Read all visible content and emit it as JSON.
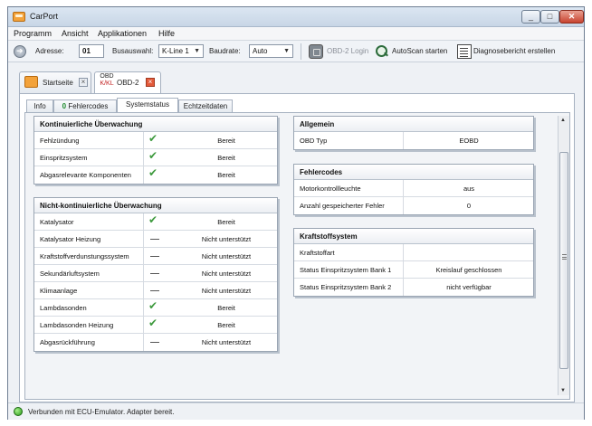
{
  "window": {
    "title": "CarPort"
  },
  "menu": [
    "Programm",
    "Ansicht",
    "Applikationen",
    "Hilfe"
  ],
  "toolbar": {
    "adresse_label": "Adresse:",
    "adresse_value": "01",
    "busauswahl_label": "Busauswahl:",
    "busauswahl_value": "K-Line 1",
    "baudrate_label": "Baudrate:",
    "baudrate_value": "Auto",
    "login_label": "OBD-2 Login",
    "autoscan_label": "AutoScan starten",
    "report_label": "Diagnosebericht erstellen"
  },
  "doc_tabs": {
    "start_label": "Startseite",
    "obd_icon_top": "OBD",
    "obd_icon_bottom": "K/KL",
    "obd_label": "OBD-2"
  },
  "sub_tabs": {
    "info": "Info",
    "fehler_count": "0",
    "fehler_label": "Fehlercodes",
    "systemstatus": "Systemstatus",
    "echtzeit": "Echtzeitdaten"
  },
  "kontinuierlich": {
    "title": "Kontinuierliche Überwachung",
    "rows": [
      {
        "name": "Fehlzündung",
        "icon": "check",
        "status": "Bereit"
      },
      {
        "name": "Einspritzsystem",
        "icon": "check",
        "status": "Bereit"
      },
      {
        "name": "Abgasrelevante Komponenten",
        "icon": "check",
        "status": "Bereit"
      }
    ]
  },
  "nicht_kontinuierlich": {
    "title": "Nicht-kontinuierliche Überwachung",
    "rows": [
      {
        "name": "Katalysator",
        "icon": "check",
        "status": "Bereit"
      },
      {
        "name": "Katalysator Heizung",
        "icon": "dash",
        "status": "Nicht unterstützt"
      },
      {
        "name": "Kraftstoffverdunstungssystem",
        "icon": "dash",
        "status": "Nicht unterstützt"
      },
      {
        "name": "Sekundärluftsystem",
        "icon": "dash",
        "status": "Nicht unterstützt"
      },
      {
        "name": "Klimaanlage",
        "icon": "dash",
        "status": "Nicht unterstützt"
      },
      {
        "name": "Lambdasonden",
        "icon": "check",
        "status": "Bereit"
      },
      {
        "name": "Lambdasonden Heizung",
        "icon": "check",
        "status": "Bereit"
      },
      {
        "name": "Abgasrückführung",
        "icon": "dash",
        "status": "Nicht unterstützt"
      }
    ]
  },
  "allgemein": {
    "title": "Allgemein",
    "rows": [
      {
        "name": "OBD Typ",
        "value": "EOBD"
      }
    ]
  },
  "fehlercodes": {
    "title": "Fehlercodes",
    "rows": [
      {
        "name": "Motorkontrollleuchte",
        "value": "aus"
      },
      {
        "name": "Anzahl gespeicherter Fehler",
        "value": "0"
      }
    ]
  },
  "kraftstoff": {
    "title": "Kraftstoffsystem",
    "rows": [
      {
        "name": "Kraftstoffart",
        "value": ""
      },
      {
        "name": "Status Einspritzsystem Bank 1",
        "value": "Kreislauf geschlossen"
      },
      {
        "name": "Status Einspritzsystem Bank 2",
        "value": "nicht verfügbar"
      }
    ]
  },
  "status": {
    "text": "Verbunden mit ECU-Emulator. Adapter bereit."
  }
}
